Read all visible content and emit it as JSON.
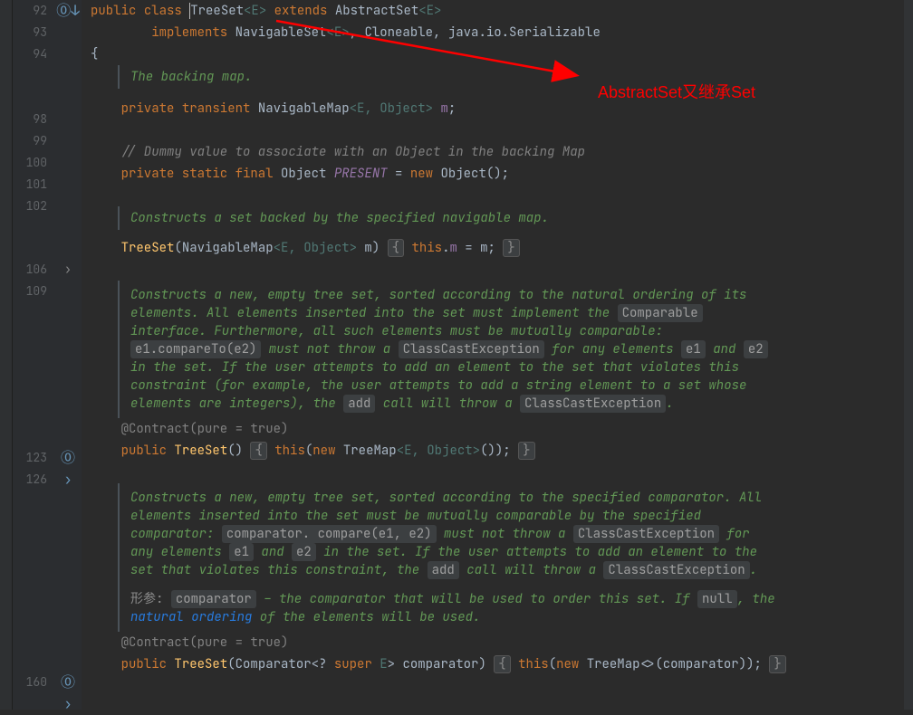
{
  "annotation": {
    "text": "AbstractSet又继承Set"
  },
  "line_numbers": [
    "92",
    "93",
    "94",
    "",
    "98",
    "99",
    "100",
    "101",
    "102",
    "",
    "106",
    "109",
    "",
    "",
    "",
    "",
    "",
    "",
    "",
    "123",
    "126",
    "",
    "",
    "",
    "",
    "",
    "",
    "",
    "",
    "",
    "",
    "160"
  ],
  "gutter_icons": {
    "l92": "⓪↓",
    "l123": "⓪ ›",
    "l160": "⓪ ›",
    "fold106": "›"
  },
  "code": {
    "l92": {
      "kw1": "public ",
      "kw2": "class ",
      "name": "TreeSet",
      "tp": "<E>",
      "kw3": " extends ",
      "sup": "AbstractSet",
      "tp2": "<E>"
    },
    "l93": {
      "kw": "implements ",
      "i1": "NavigableSet",
      "tp": "<E>",
      "sep": ", ",
      "i2": "Cloneable",
      "sep2": ", ",
      "i3": "java.io.Serializable"
    },
    "l94": "{",
    "doc1": "The backing map.",
    "l98": {
      "kw1": "private ",
      "kw2": "transient ",
      "type": "NavigableMap",
      "tp": "<E, Object> ",
      "var": "m",
      "end": ";"
    },
    "l100": "// Dummy value to associate with an Object in the backing Map",
    "l101": {
      "kw": "private static final ",
      "type": "Object ",
      "name": "PRESENT",
      "eq": " = ",
      "newkw": "new ",
      "ctor": "Object",
      "end": "();"
    },
    "doc2": "Constructs a set backed by the specified navigable map.",
    "l106": {
      "name": "TreeSet",
      "p1": "(NavigableMap",
      "tp": "<E, Object>",
      "p2": " m) ",
      "fold1": "{",
      "body": " this.m = m; ",
      "fold2": "}"
    },
    "doc3_1": "Constructs a new, empty tree set, sorted according to the natural ordering of its elements. All elements inserted into the set must implement the ",
    "doc3_link1": "Comparable",
    "doc3_2": " interface. Furthermore, all such elements must be ",
    "doc3_em1": "mutually comparable",
    "doc3_3": ": ",
    "doc3_code1": "e1.compareTo(e2)",
    "doc3_4": " must not throw a ",
    "doc3_code2": "ClassCastException",
    "doc3_5": " for any elements ",
    "doc3_code3": "e1",
    "doc3_6": " and ",
    "doc3_code4": "e2",
    "doc3_7": " in the set. If the user attempts to add an element to the set that violates this constraint (for example, the user attempts to add a string element to a set whose elements are integers), the ",
    "doc3_code5": "add",
    "doc3_8": " call will throw a ",
    "doc3_code6": "ClassCastException",
    "doc3_9": ".",
    "contract1": "@Contract(pure = true)",
    "l123": {
      "kw": "public ",
      "name": "TreeSet",
      "p": "() ",
      "fold1": "{",
      "body1": " this(",
      "newkw": "new ",
      "ctor": "TreeMap",
      "tp": "<E, Object>",
      "body2": "()); ",
      "fold2": "}"
    },
    "doc4_1": "Constructs a new, empty tree set, sorted according to the specified comparator. All elements inserted into the set must be ",
    "doc4_em1": "mutually comparable",
    "doc4_2": " by the specified comparator: ",
    "doc4_code1": "comparator. compare(e1, e2)",
    "doc4_3": " must not throw a ",
    "doc4_code2": "ClassCastException",
    "doc4_4": " for any elements ",
    "doc4_code3": "e1",
    "doc4_5": " and ",
    "doc4_code4": "e2",
    "doc4_6": " in the set. If the user attempts to add an element to the set that violates this constraint, the ",
    "doc4_code5": "add",
    "doc4_7": " call will throw a ",
    "doc4_code6": "ClassCastException",
    "doc4_8": ".",
    "doc4_param_label": "形参: ",
    "doc4_param_name": "comparator",
    "doc4_param_1": " – the comparator that will be used to order this set. If ",
    "doc4_param_null": "null",
    "doc4_param_2": ", the ",
    "doc4_param_link": "natural ordering",
    "doc4_param_3": " of the elements will be used.",
    "contract2": "@Contract(pure = true)",
    "l160": {
      "kw": "public ",
      "name": "TreeSet",
      "p1": "(Comparator<? ",
      "kw2": "super ",
      "tp": "E",
      "p2": "> comparator) ",
      "fold1": "{",
      "body1": " this(",
      "newkw": "new ",
      "ctor": "TreeMap<>",
      "body2": "(comparator)); ",
      "fold2": "}"
    }
  }
}
